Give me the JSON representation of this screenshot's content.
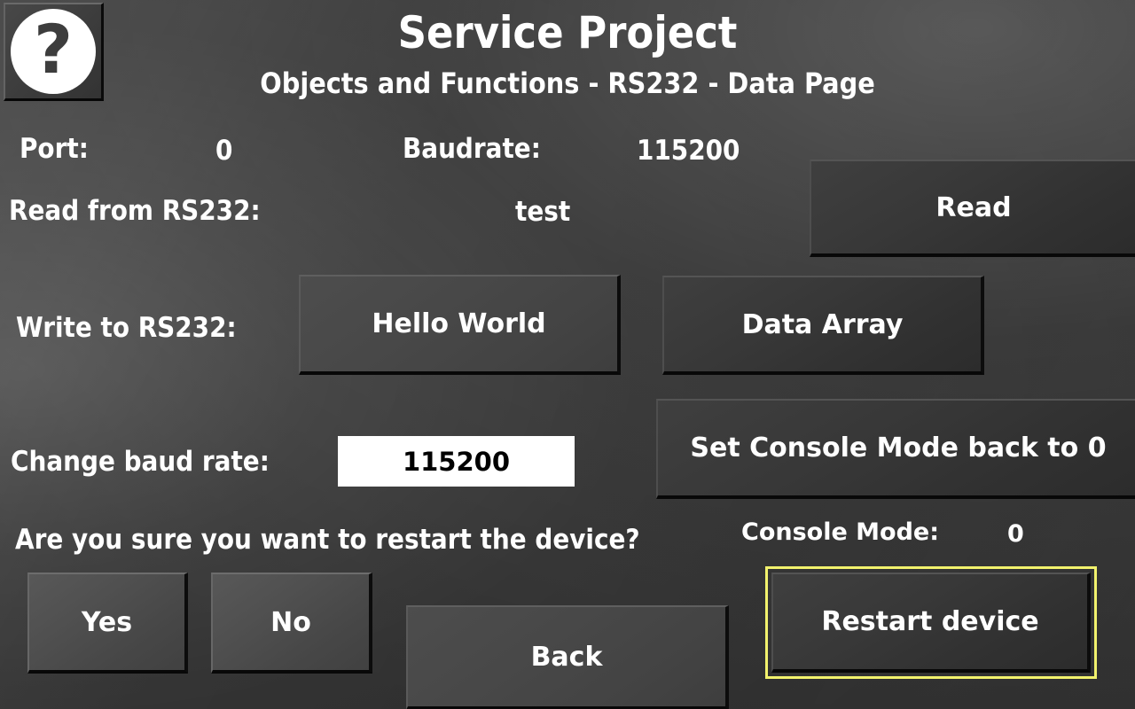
{
  "header": {
    "help_icon": "question-mark-icon",
    "title": "Service Project",
    "subtitle": "Objects and Functions - RS232 - Data Page"
  },
  "fields": {
    "port_label": "Port:",
    "port_value": "0",
    "baudrate_label": "Baudrate:",
    "baudrate_value": "115200",
    "read_label": "Read from RS232:",
    "read_value": "test",
    "write_label": "Write to RS232:",
    "change_baud_label": "Change baud rate:",
    "change_baud_value": "115200",
    "console_mode_label": "Console Mode:",
    "console_mode_value": "0",
    "restart_question": "Are you sure you want to restart the device?"
  },
  "buttons": {
    "read": "Read",
    "hello_world": "Hello World",
    "data_array": "Data Array",
    "set_console_mode": "Set Console Mode back to 0",
    "yes": "Yes",
    "no": "No",
    "back": "Back",
    "restart_device": "Restart device"
  },
  "colors": {
    "background": "#424242",
    "button_face": "#383838",
    "focus_outline": "#f2f26d",
    "input_background": "#ffffff",
    "text": "#ffffff"
  }
}
